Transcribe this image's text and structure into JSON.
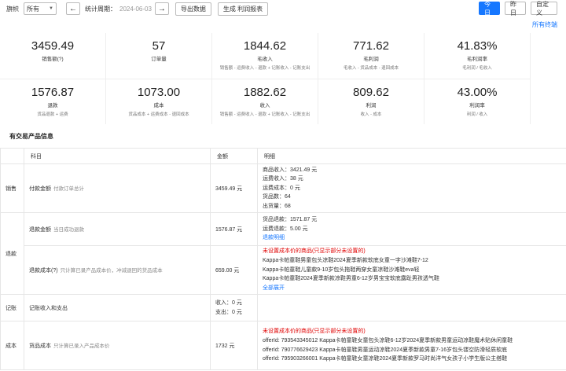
{
  "toolbar": {
    "flag_label": "旗帜",
    "flag_value": "所有",
    "period_label": "统计周期：",
    "date": "2024-06-03",
    "export_label": "导出数据",
    "generate_label": "生成 利润报表",
    "today_label": "今日",
    "yesterday_label": "昨日",
    "custom_label": "自定义",
    "all_terminals_label": "所有终端"
  },
  "stats_row1": [
    {
      "value": "3459.49",
      "name": "销售额(?)",
      "formula": ""
    },
    {
      "value": "57",
      "name": "订单量",
      "formula": ""
    },
    {
      "value": "1844.62",
      "name": "毛收入",
      "formula": "销售额 - 运费收入 - 退款 + 记账收入 - 记账支出"
    },
    {
      "value": "771.62",
      "name": "毛利润",
      "formula": "毛收入 - 货品成本 - 退回成本"
    },
    {
      "value": "41.83%",
      "name": "毛利润率",
      "formula": "毛利润 / 毛收入"
    }
  ],
  "stats_row2": [
    {
      "value": "1576.87",
      "name": "退款",
      "formula": "货品退款 + 运费"
    },
    {
      "value": "1073.00",
      "name": "成本",
      "formula": "货品成本 + 运费成本 - 退回成本"
    },
    {
      "value": "1882.62",
      "name": "收入",
      "formula": "销售额 - 运费收入 - 退款 + 记账收入 - 记账支出"
    },
    {
      "value": "809.62",
      "name": "利润",
      "formula": "收入 - 成本"
    },
    {
      "value": "43.00%",
      "name": "利润率",
      "formula": "利润 / 收入"
    }
  ],
  "section_title": "有交易产品信息",
  "table": {
    "headers": {
      "item": "科目",
      "amount": "金额",
      "detail": "明细"
    },
    "sales": {
      "category": "销售",
      "item": "付款金额",
      "note": "付款订单总计",
      "amount": "3459.49 元",
      "details": [
        "商品收入：3421.49 元",
        "运费收入：38 元",
        "运费成本：0 元",
        "货品数：64",
        "出货量：68"
      ]
    },
    "refund": {
      "category": "退款",
      "item1": "退款金额",
      "note1": "当日成功退款",
      "amount1": "1576.87 元",
      "details1": [
        "货品退款：1571.87 元",
        "运费退款：5.00 元"
      ],
      "link1": "退款明细",
      "item2": "退款成本(?)",
      "note2": "只计算已录产品成本价，冲减退回的货品成本",
      "amount2": "659.00 元",
      "warn2": "未设置成本价的商品(只显示部分未设置的)",
      "lines2": [
        "Kappa卡帕童鞋男童包头凉鞋2024夏季新款软底女童一字沙滩鞋7-12",
        "Kappa卡帕童鞋儿童款9-10岁包头拖鞋两穿女童凉鞋沙滩鞋eva轻",
        "Kappa卡帕童鞋2024夏季新款凉鞋男童6-12岁男宝宝软底露趾男孩透气鞋"
      ],
      "expand2": "全部展开"
    },
    "ledger": {
      "category": "记账",
      "item": "记账收入和支出",
      "details": [
        "收入：0 元",
        "支出：0 元"
      ]
    },
    "cost": {
      "category": "成本",
      "item": "货品成本",
      "note": "只计算已录入产品成本价",
      "amount": "1732 元",
      "warn": "未设置成本价的商品(只显示部分未设置的)",
      "lines": [
        "offerId: 793543345012 Kappa卡帕童鞋女童包头凉鞋6-12岁2024夏季新款男童运动凉鞋魔术贴休闲童鞋",
        "offerId: 790776629423 Kappa卡帕童鞋男童运动凉鞋2024夏季新款男童7-16岁包头镂空防滑轻质软底",
        "offerId: 795903266001 Kappa卡帕童鞋女童凉鞋2024夏季新款罗马时尚洋气女孩子小学生版公主搭鞋"
      ]
    }
  }
}
